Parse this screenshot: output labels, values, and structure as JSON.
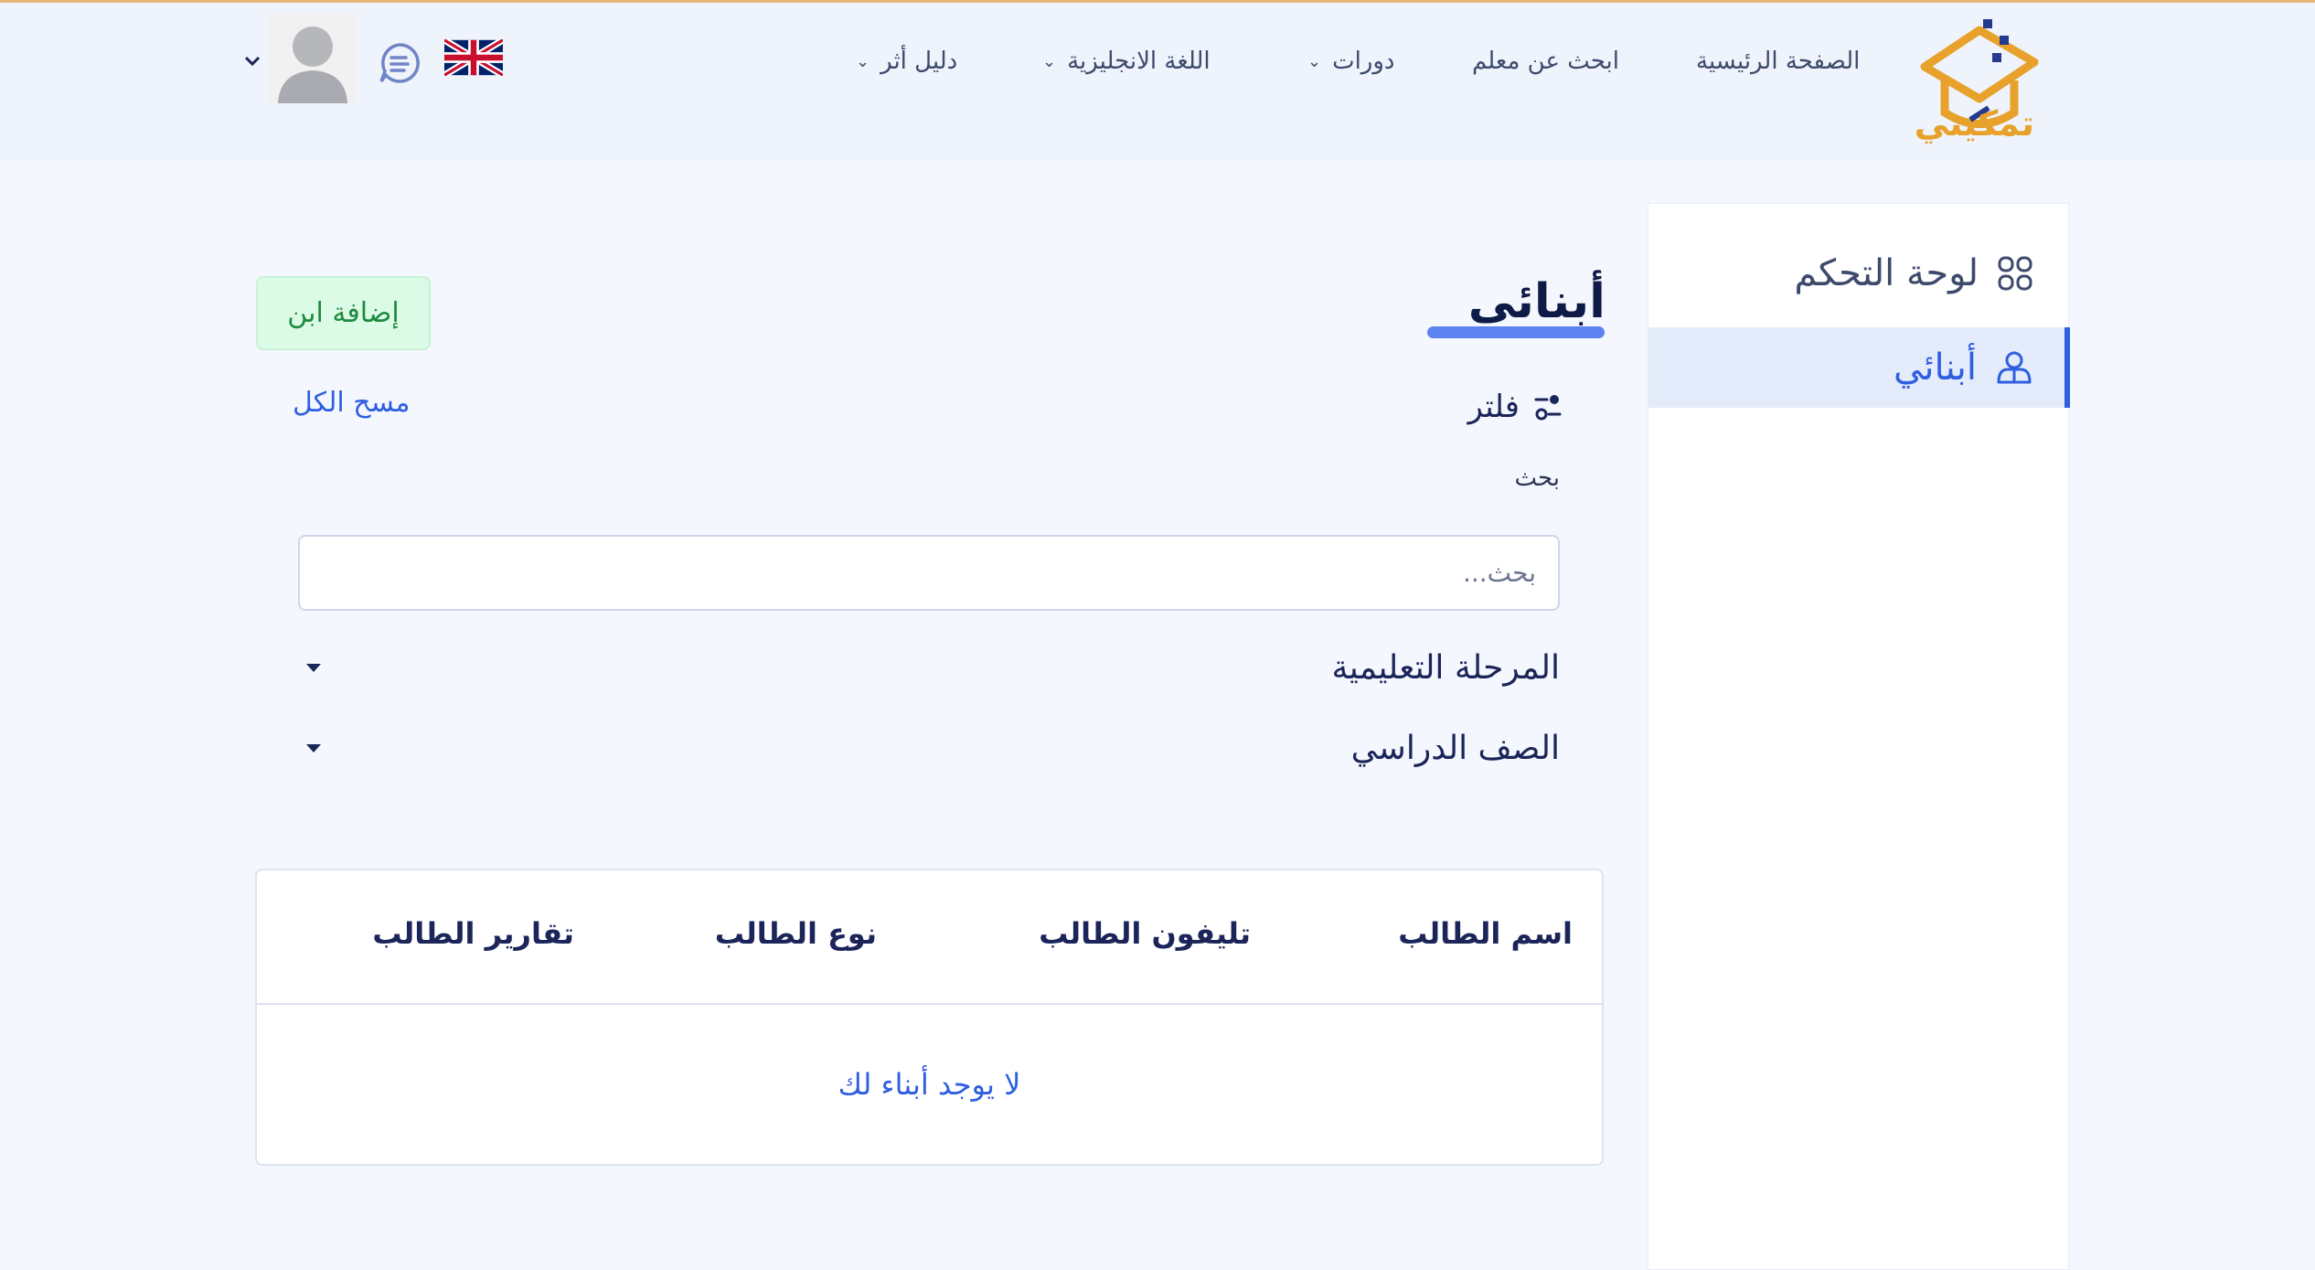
{
  "header": {
    "logo_text": "تمكيني",
    "nav": [
      {
        "label": "الصفحة الرئيسية",
        "has_dropdown": false
      },
      {
        "label": "ابحث عن معلم",
        "has_dropdown": false
      },
      {
        "label": "دورات",
        "has_dropdown": true
      },
      {
        "label": "اللغة الانجليزية",
        "has_dropdown": true
      },
      {
        "label": "دليل أثر",
        "has_dropdown": true
      }
    ],
    "language_flag": "uk-flag-icon",
    "chat_icon": "chat-icon",
    "avatar": "user-avatar"
  },
  "sidebar": {
    "items": [
      {
        "label": "لوحة التحكم",
        "icon": "grid-icon",
        "active": false
      },
      {
        "label": "أبنائي",
        "icon": "users-icon",
        "active": true
      }
    ]
  },
  "main": {
    "title": "أبنائى",
    "add_button": "إضافة ابن",
    "filter_label": "فلتر",
    "clear_all": "مسح الكل",
    "search_label": "بحث",
    "search_placeholder": "بحث...",
    "search_value": "",
    "selects": [
      {
        "label": "المرحلة التعليمية"
      },
      {
        "label": "الصف الدراسي"
      }
    ],
    "table": {
      "headers": [
        "اسم الطالب",
        "تليفون الطالب",
        "نوع الطالب",
        "تقارير الطالب"
      ],
      "empty_message": "لا يوجد أبناء لك"
    }
  },
  "colors": {
    "accent": "#2f5fe0",
    "logo": "#e8a22b",
    "add_button_bg": "#dcfbe7",
    "add_button_text": "#1e8a3f"
  }
}
